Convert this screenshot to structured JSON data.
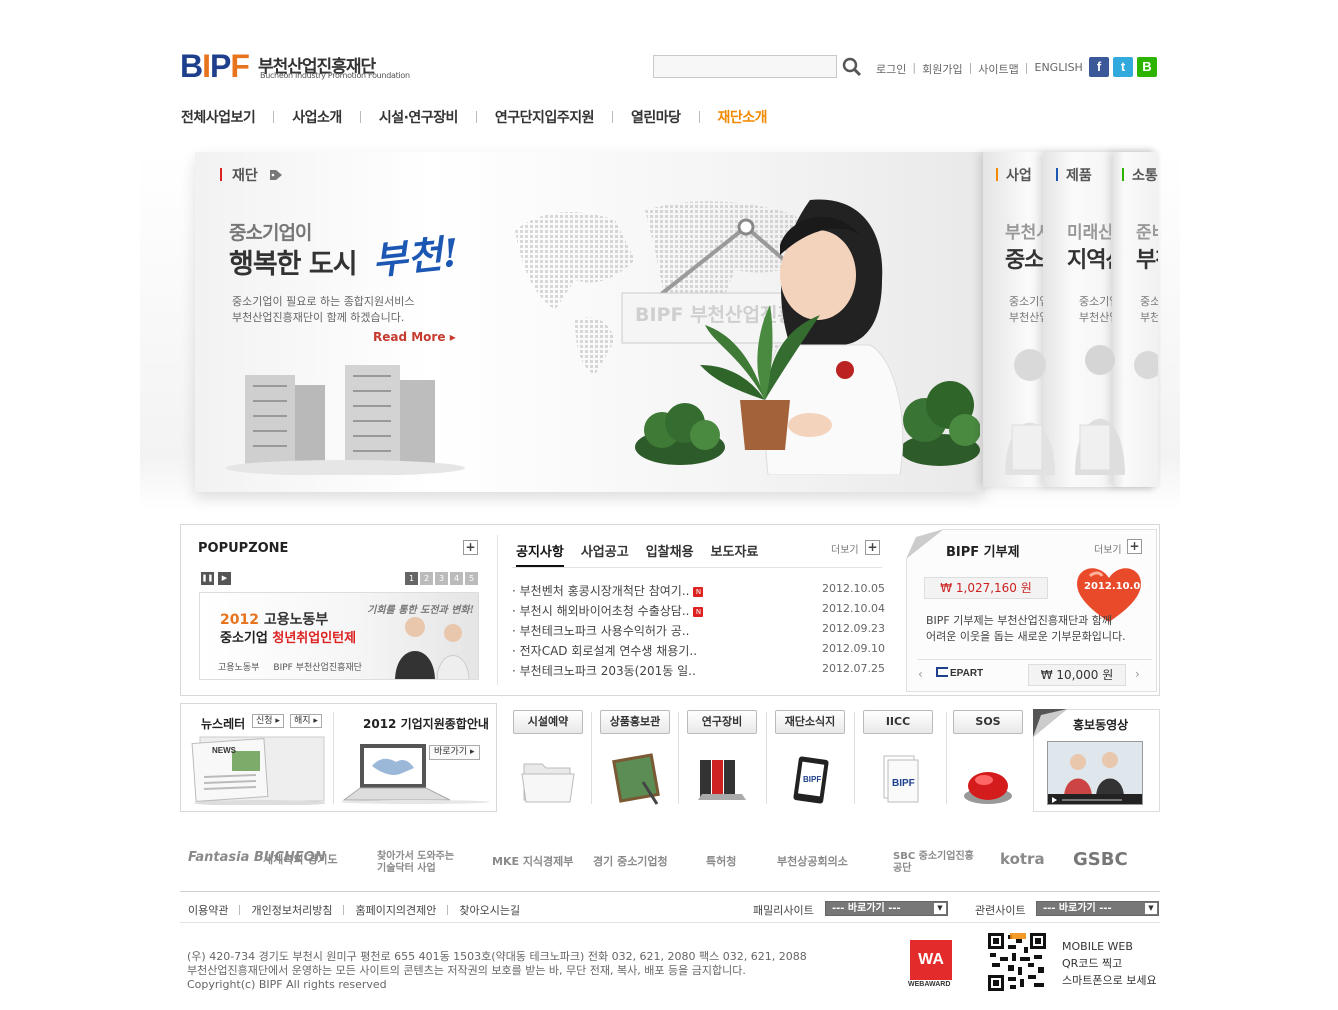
{
  "header": {
    "logo_text": "BIPF",
    "logo_kr": "부천산업진흥재단",
    "logo_en": "Bucheon Industry Promotion Foundation",
    "search_placeholder": "",
    "util_links": [
      "로그인",
      "회원가입",
      "사이트맵",
      "ENGLISH"
    ],
    "sns": [
      {
        "name": "facebook",
        "glyph": "f",
        "color": "#3b5998"
      },
      {
        "name": "twitter",
        "glyph": "t",
        "color": "#33aadd"
      },
      {
        "name": "blog",
        "glyph": "B",
        "color": "#2db400"
      }
    ]
  },
  "nav": {
    "items": [
      "전체사업보기",
      "사업소개",
      "시설·연구장비",
      "연구단지입주지원",
      "열린마당",
      "재단소개"
    ],
    "active": "재단소개"
  },
  "hero": {
    "tab_label": "재단",
    "subtitle": "중소기업이",
    "title": "행복한 도시",
    "accent": "부천!",
    "desc_1": "중소기업이 필요로 하는 종합지원서비스",
    "desc_2": "부천산업진흥재단이 함께 하겠습니다.",
    "read_more": "Read More",
    "sign_text": "BIPF 부천산업진흥재단",
    "side_panels": [
      {
        "tab": "사업",
        "bar_color": "#f08a00",
        "line1": "부천시",
        "line2": "중소기",
        "small1": "중소기업",
        "small2": "부천산업"
      },
      {
        "tab": "제품",
        "bar_color": "#1b57b3",
        "line1": "미래산",
        "line2": "지역산",
        "small1": "중소기업",
        "small2": "부천산업"
      },
      {
        "tab": "소통",
        "bar_color": "#2db400",
        "line1": "준비된",
        "line2": "부천시",
        "small1": "중소기업",
        "small2": "부천시"
      }
    ]
  },
  "popupzone": {
    "title": "POPUPZONE",
    "pages": [
      "1",
      "2",
      "3",
      "4",
      "5"
    ],
    "banner_year": "2012",
    "banner_line1": "고용노동부",
    "banner_line2a": "중소기업",
    "banner_line2b": "청년취업인턴제",
    "banner_slogan": "기회를 통한 도전과 변화!",
    "banner_ministry": "고용노동부",
    "banner_bipf": "BIPF 부천산업진흥재단"
  },
  "notice": {
    "tabs": [
      "공지사항",
      "사업공고",
      "입찰채용",
      "보도자료"
    ],
    "more": "더보기",
    "items": [
      {
        "title": "부천벤처 홍콩시장개척단 참여기..",
        "date": "2012.10.05",
        "new": true
      },
      {
        "title": "부천시 해외바이어초청 수출상담..",
        "date": "2012.10.04",
        "new": true
      },
      {
        "title": "부천테크노파크 사용수익허가 공..",
        "date": "2012.09.23",
        "new": false
      },
      {
        "title": "전자CAD 회로설계 연수생 채용기..",
        "date": "2012.09.10",
        "new": false
      },
      {
        "title": "부천테크노파크 203동(201동 일..",
        "date": "2012.07.25",
        "new": false
      }
    ]
  },
  "donation": {
    "title": "BIPF 기부제",
    "more": "더보기",
    "total": "₩ 1,027,160 원",
    "date_badge": "2012.10.09",
    "desc_1": "BIPF 기부제는 부천산업진흥재단과 함께",
    "desc_2": "어려운 이웃을 돕는 새로운 기부문화입니다.",
    "donor_logo": "EPART",
    "donor_amount": "₩ 10,000 원"
  },
  "newsletter": {
    "title": "뉴스레터",
    "subscribe": "신청",
    "unsubscribe": "해지",
    "news_label": "NEWS"
  },
  "guide": {
    "title": "2012 기업지원종합안내",
    "button": "바로가기"
  },
  "quick_menu": [
    {
      "label": "시설예약",
      "icon": "folder-icon"
    },
    {
      "label": "상품홍보관",
      "icon": "board-icon"
    },
    {
      "label": "연구장비",
      "icon": "binder-icon"
    },
    {
      "label": "재단소식지",
      "icon": "tablet-icon"
    },
    {
      "label": "IICC",
      "icon": "document-icon"
    },
    {
      "label": "SOS",
      "icon": "alarm-button-icon"
    }
  ],
  "video": {
    "title": "홍보동영상"
  },
  "partners": [
    "Fantasia BUCHEON",
    "세계속의 경기도",
    "찾아가서 도와주는 기술닥터 사업",
    "MKE 지식경제부",
    "경기 중소기업청",
    "특허청",
    "부천상공회의소",
    "SBC 중소기업진흥공단",
    "kotra",
    "GSBC"
  ],
  "footer": {
    "links": [
      "이용약관",
      "개인정보처리방침",
      "홈페이지의견제안",
      "찾아오시는길"
    ],
    "family_label": "패밀리사이트",
    "related_label": "관련사이트",
    "select_text": "--- 바로가기 ---",
    "address_1": "(우) 420-734 경기도 부천시 원미구 평천로 655 401동 1503호(약대동 테크노파크)   전화 032, 621, 2080   팩스 032, 621, 2088",
    "address_2": "부천산업진흥재단에서 운영하는 모든 사이트의 콘텐츠는 저작권의 보호를 받는 바, 무단 전재, 복사, 배포 등을 금지합니다.",
    "copyright": "Copyright(c) BIPF All rights reserved",
    "award_mark": "WA",
    "award": "WEBAWARD",
    "mobile_1": "MOBILE WEB",
    "mobile_2": "QR코드 찍고",
    "mobile_3": "스마트폰으로 보세요"
  }
}
